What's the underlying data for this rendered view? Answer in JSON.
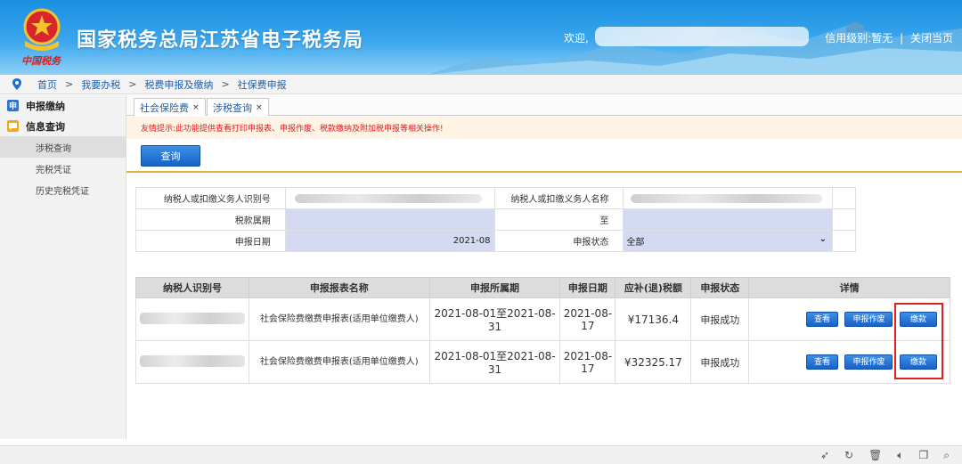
{
  "header": {
    "site_title": "国家税务总局江苏省电子税务局",
    "seal_text": "中国税务",
    "welcome": "欢迎,",
    "credit_label": "信用级别:暂无",
    "separator": "|",
    "close_label": "关闭当页"
  },
  "breadcrumb": {
    "items": [
      "首页",
      "我要办税",
      "税费申报及缴纳",
      "社保费申报"
    ],
    "separator": ">"
  },
  "sidebar": {
    "sections": [
      {
        "label": "申报缴纳",
        "icon_char": "申"
      },
      {
        "label": "信息查询"
      }
    ],
    "items": [
      "涉税查询",
      "完税凭证",
      "历史完税凭证"
    ]
  },
  "tabs": [
    {
      "label": "社会保险费",
      "close": "×"
    },
    {
      "label": "涉税查询",
      "close": "×"
    }
  ],
  "warning": "友情提示:此功能提供查看打印申报表、申报作废、税款缴纳及附加税申报等相关操作!",
  "query_button": "查询",
  "form": {
    "taxpayer_id_label": "纳税人或扣缴义务人识别号",
    "taxpayer_name_label": "纳税人或扣缴义务人名称",
    "period_label": "税款属期",
    "to_label": "至",
    "report_date_label": "申报日期",
    "report_date_value": "2021-08",
    "status_label": "申报状态",
    "status_value": "全部"
  },
  "results": {
    "columns": [
      "纳税人识别号",
      "申报报表名称",
      "申报所属期",
      "申报日期",
      "应补(退)税额",
      "申报状态",
      "详情"
    ],
    "rows": [
      {
        "form_name": "社会保险费缴费申报表(适用单位缴费人)",
        "period": "2021-08-01至2021-08-31",
        "date": "2021-08-17",
        "amount": "¥17136.4",
        "status": "申报成功"
      },
      {
        "form_name": "社会保险费缴费申报表(适用单位缴费人)",
        "period": "2021-08-01至2021-08-31",
        "date": "2021-08-17",
        "amount": "¥32325.17",
        "status": "申报成功"
      }
    ],
    "actions": {
      "view": "查看",
      "void": "申报作废",
      "pay": "缴款"
    }
  },
  "colors": {
    "header_blue": "#1a8fe0",
    "button_blue": "#1662c8",
    "warning_red": "#e01b1b",
    "highlight_red": "#e02020",
    "form_field_bg": "#d3daf2"
  }
}
